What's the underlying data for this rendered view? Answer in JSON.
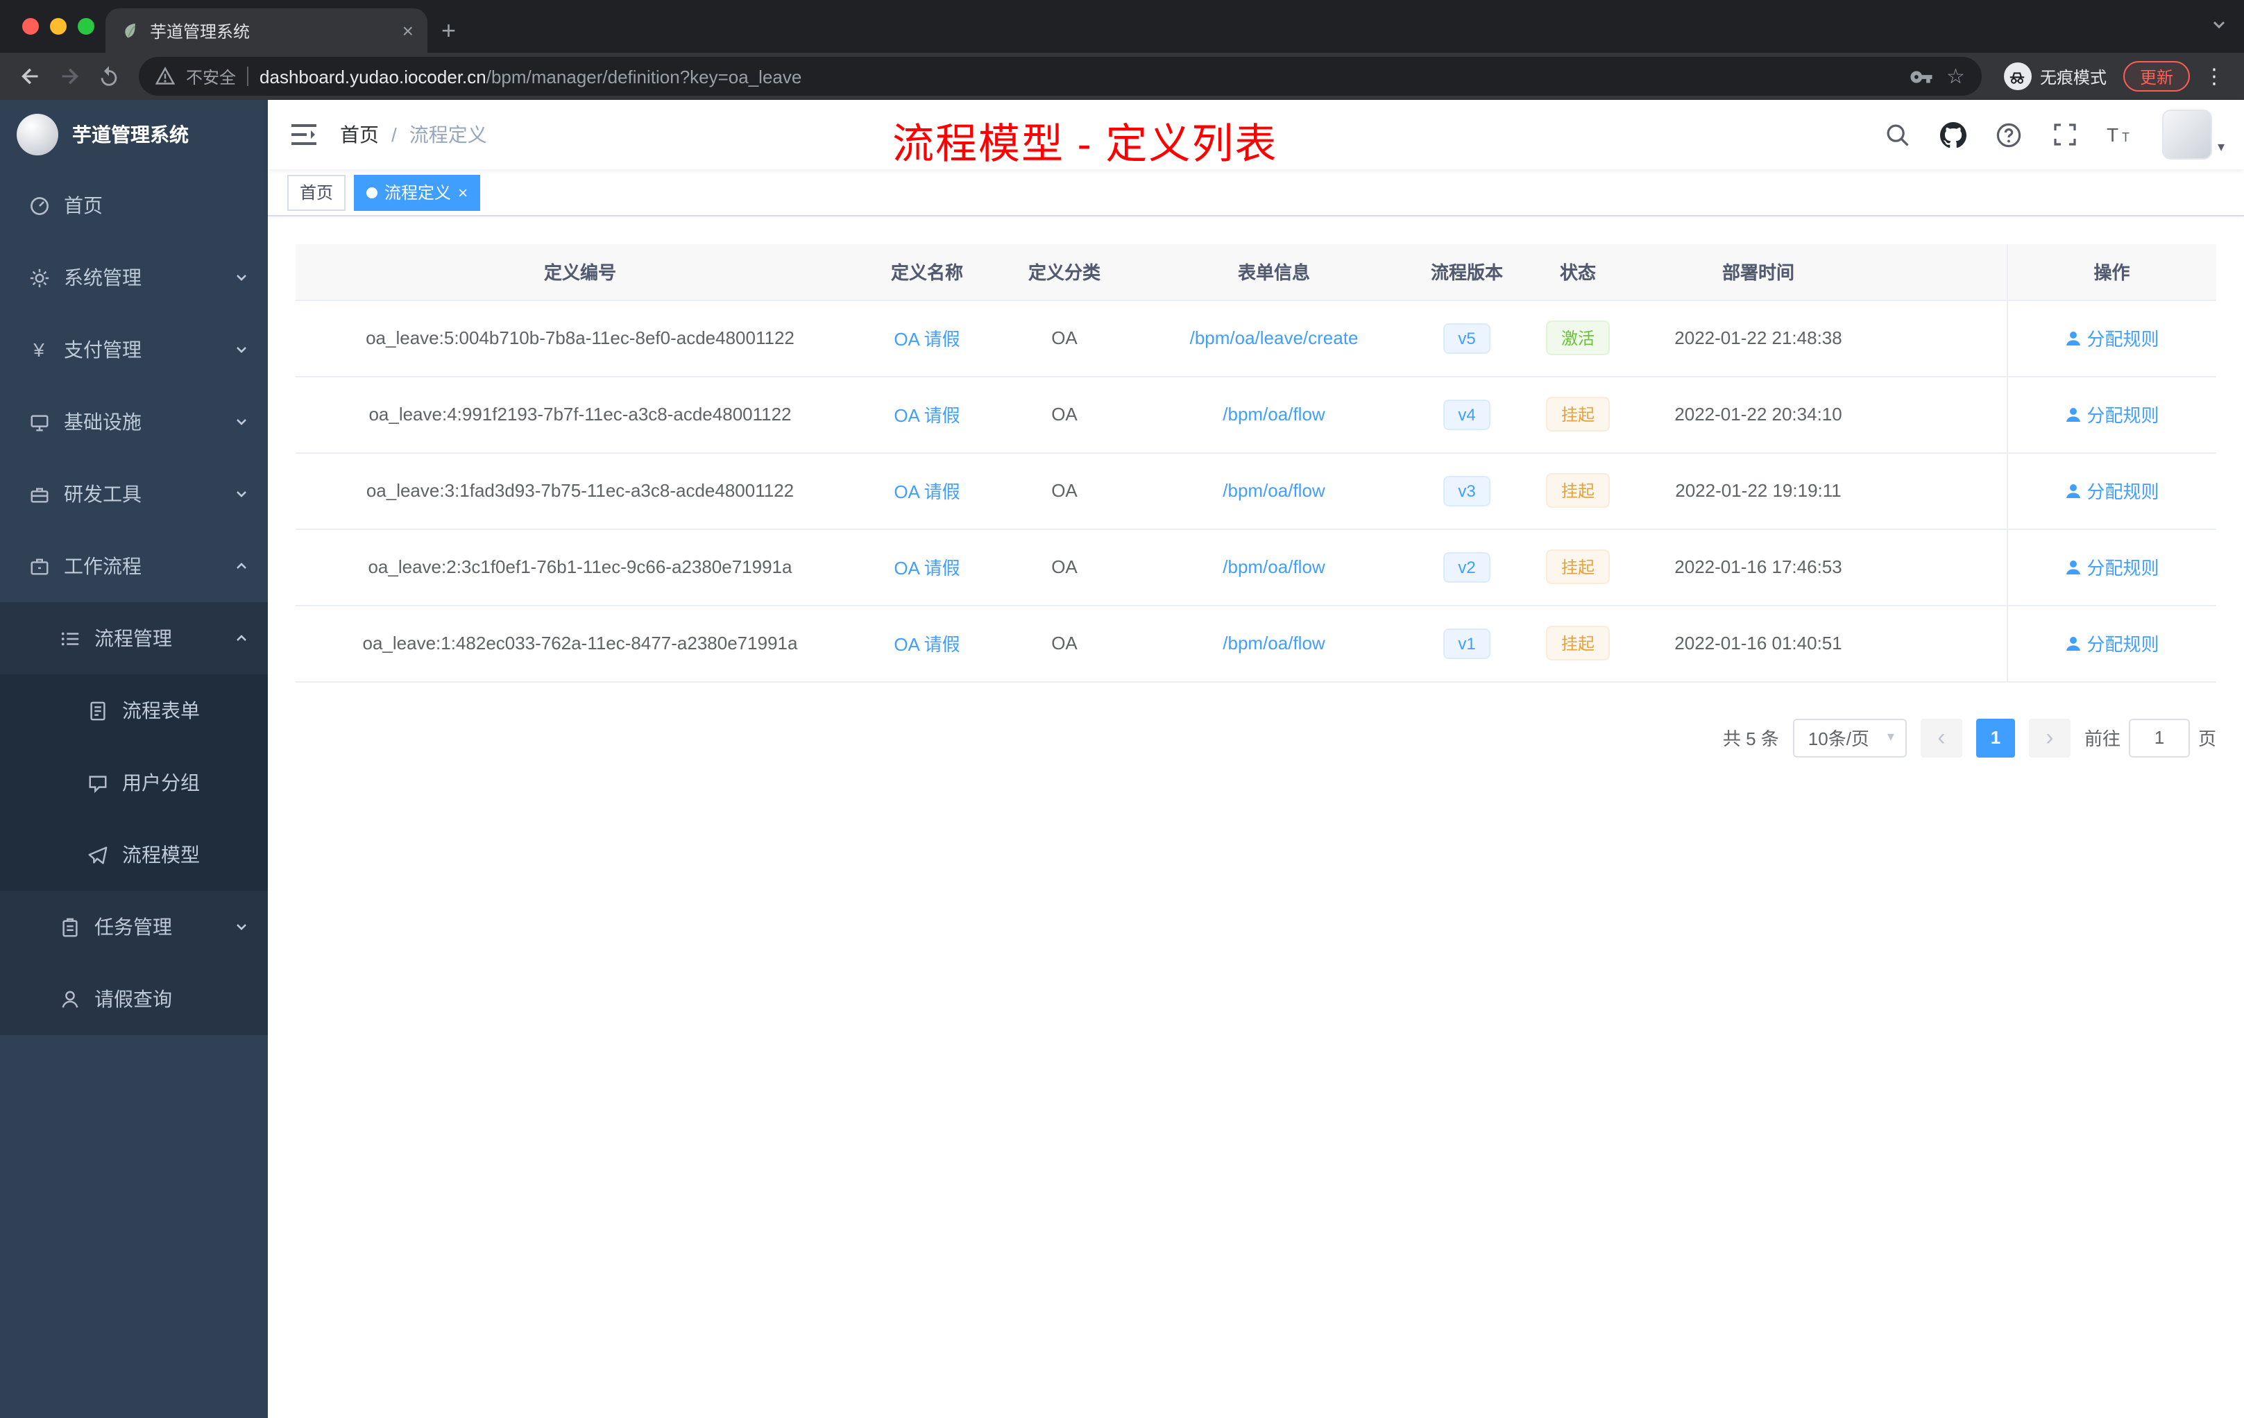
{
  "glyphs": {
    "close": "×",
    "plus": "+",
    "kebab": "⋮",
    "star": "☆",
    "caret": "▾",
    "prev": "‹",
    "next": "›",
    "yen": "¥"
  },
  "colors": {
    "accent": "#409eff",
    "annotation_red": "#fe0000",
    "success_green": "#67c23a",
    "warning_orange": "#e6a23c",
    "sidebar_bg": "#304156"
  },
  "browser": {
    "tab_title": "芋道管理系统",
    "security_label": "不安全",
    "url_host": "dashboard.yudao.iocoder.cn",
    "url_path": "/bpm/manager/definition?key=oa_leave",
    "incognito_label": "无痕模式",
    "update_label": "更新"
  },
  "sidebar": {
    "title": "芋道管理系统",
    "items": [
      {
        "label": "首页"
      },
      {
        "label": "系统管理"
      },
      {
        "label": "支付管理"
      },
      {
        "label": "基础设施"
      },
      {
        "label": "研发工具"
      },
      {
        "label": "工作流程"
      },
      {
        "label": "流程管理"
      },
      {
        "label": "流程表单"
      },
      {
        "label": "用户分组"
      },
      {
        "label": "流程模型"
      },
      {
        "label": "任务管理"
      },
      {
        "label": "请假查询"
      }
    ]
  },
  "header": {
    "breadcrumb_home": "首页",
    "breadcrumb_separator": "/",
    "breadcrumb_current": "流程定义",
    "annotation": "流程模型 - 定义列表"
  },
  "tags": {
    "home": "首页",
    "active": "流程定义"
  },
  "table": {
    "columns": [
      "定义编号",
      "定义名称",
      "定义分类",
      "表单信息",
      "流程版本",
      "状态",
      "部署时间",
      "操作"
    ],
    "rows": [
      {
        "id": "oa_leave:5:004b710b-7b8a-11ec-8ef0-acde48001122",
        "name": "OA 请假",
        "category": "OA",
        "form": "/bpm/oa/leave/create",
        "version": "v5",
        "status": "激活",
        "time": "2022-01-22 21:48:38",
        "action": "分配规则"
      },
      {
        "id": "oa_leave:4:991f2193-7b7f-11ec-a3c8-acde48001122",
        "name": "OA 请假",
        "category": "OA",
        "form": "/bpm/oa/flow",
        "version": "v4",
        "status": "挂起",
        "time": "2022-01-22 20:34:10",
        "action": "分配规则"
      },
      {
        "id": "oa_leave:3:1fad3d93-7b75-11ec-a3c8-acde48001122",
        "name": "OA 请假",
        "category": "OA",
        "form": "/bpm/oa/flow",
        "version": "v3",
        "status": "挂起",
        "time": "2022-01-22 19:19:11",
        "action": "分配规则"
      },
      {
        "id": "oa_leave:2:3c1f0ef1-76b1-11ec-9c66-a2380e71991a",
        "name": "OA 请假",
        "category": "OA",
        "form": "/bpm/oa/flow",
        "version": "v2",
        "status": "挂起",
        "time": "2022-01-16 17:46:53",
        "action": "分配规则"
      },
      {
        "id": "oa_leave:1:482ec033-762a-11ec-8477-a2380e71991a",
        "name": "OA 请假",
        "category": "OA",
        "form": "/bpm/oa/flow",
        "version": "v1",
        "status": "挂起",
        "time": "2022-01-16 01:40:51",
        "action": "分配规则"
      }
    ]
  },
  "pagination": {
    "total": "共 5 条",
    "page_size": "10条/页",
    "current_page": "1",
    "goto_label": "前往",
    "page_unit": "页",
    "goto_value": "1"
  }
}
